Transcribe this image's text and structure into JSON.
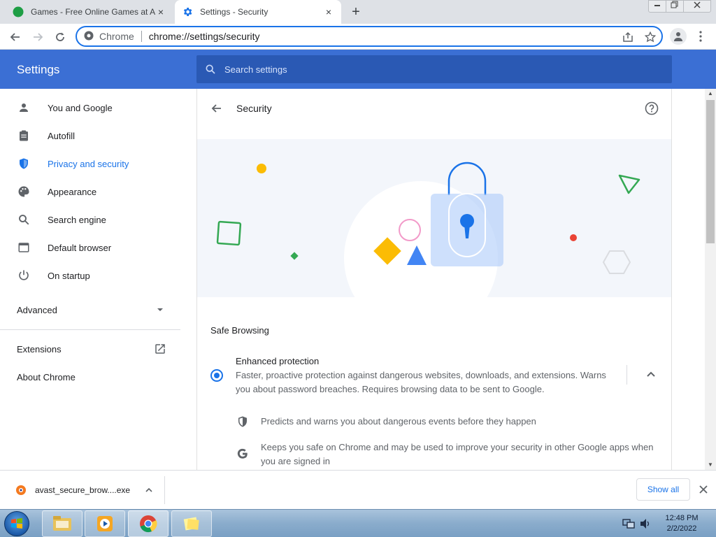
{
  "tabs": [
    {
      "title": "Games - Free Online Games at A",
      "close": "×"
    },
    {
      "title": "Settings - Security",
      "close": "×"
    }
  ],
  "new_tab": "+",
  "omnibox": {
    "site": "Chrome",
    "url": "chrome://settings/security"
  },
  "settings": {
    "title": "Settings",
    "search_placeholder": "Search settings"
  },
  "sidebar": {
    "items": [
      {
        "label": "You and Google",
        "icon": "person-icon"
      },
      {
        "label": "Autofill",
        "icon": "clipboard-icon"
      },
      {
        "label": "Privacy and security",
        "icon": "shield-icon"
      },
      {
        "label": "Appearance",
        "icon": "palette-icon"
      },
      {
        "label": "Search engine",
        "icon": "search-icon"
      },
      {
        "label": "Default browser",
        "icon": "browser-icon"
      },
      {
        "label": "On startup",
        "icon": "power-icon"
      }
    ],
    "advanced": "Advanced",
    "extensions": "Extensions",
    "about": "About Chrome"
  },
  "security": {
    "title": "Security",
    "safe_browsing_label": "Safe Browsing",
    "enhanced_title": "Enhanced protection",
    "enhanced_desc": "Faster, proactive protection against dangerous websites, downloads, and extensions. Warns you about password breaches. Requires browsing data to be sent to Google.",
    "features": [
      {
        "text": "Predicts and warns you about dangerous events before they happen",
        "icon": "shield-small-icon"
      },
      {
        "text": "Keeps you safe on Chrome and may be used to improve your security in other Google apps when you are signed in",
        "icon": "google-g-icon"
      }
    ]
  },
  "downloads": {
    "file_name": "avast_secure_brow....exe",
    "show_all": "Show all"
  },
  "clock": {
    "time": "12:48 PM",
    "date": "2/2/2022"
  },
  "colors": {
    "accent": "#1a73e8",
    "header": "#3b6fd4",
    "search": "#2a59b4"
  }
}
